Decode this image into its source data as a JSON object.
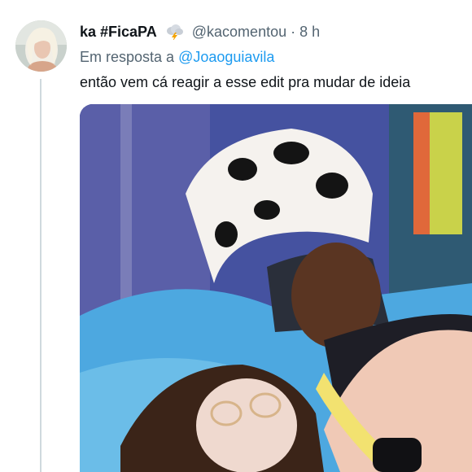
{
  "tweet": {
    "display_name": "ka #FicaPA",
    "badge_icon": "cloud-lightning-icon",
    "handle": "@kacomentou",
    "separator": "·",
    "time": "8 h",
    "reply_prefix": "Em resposta a",
    "reply_mention": "@Joaoguiavila",
    "text": "então vem cá reagir a esse edit pra mudar de ideia"
  },
  "media": {
    "description_icon": "photo",
    "kind": "image"
  },
  "colors": {
    "text_primary": "#0f1419",
    "text_secondary": "#536471",
    "link": "#1d9bf0",
    "thread_line": "#cfd9de"
  }
}
